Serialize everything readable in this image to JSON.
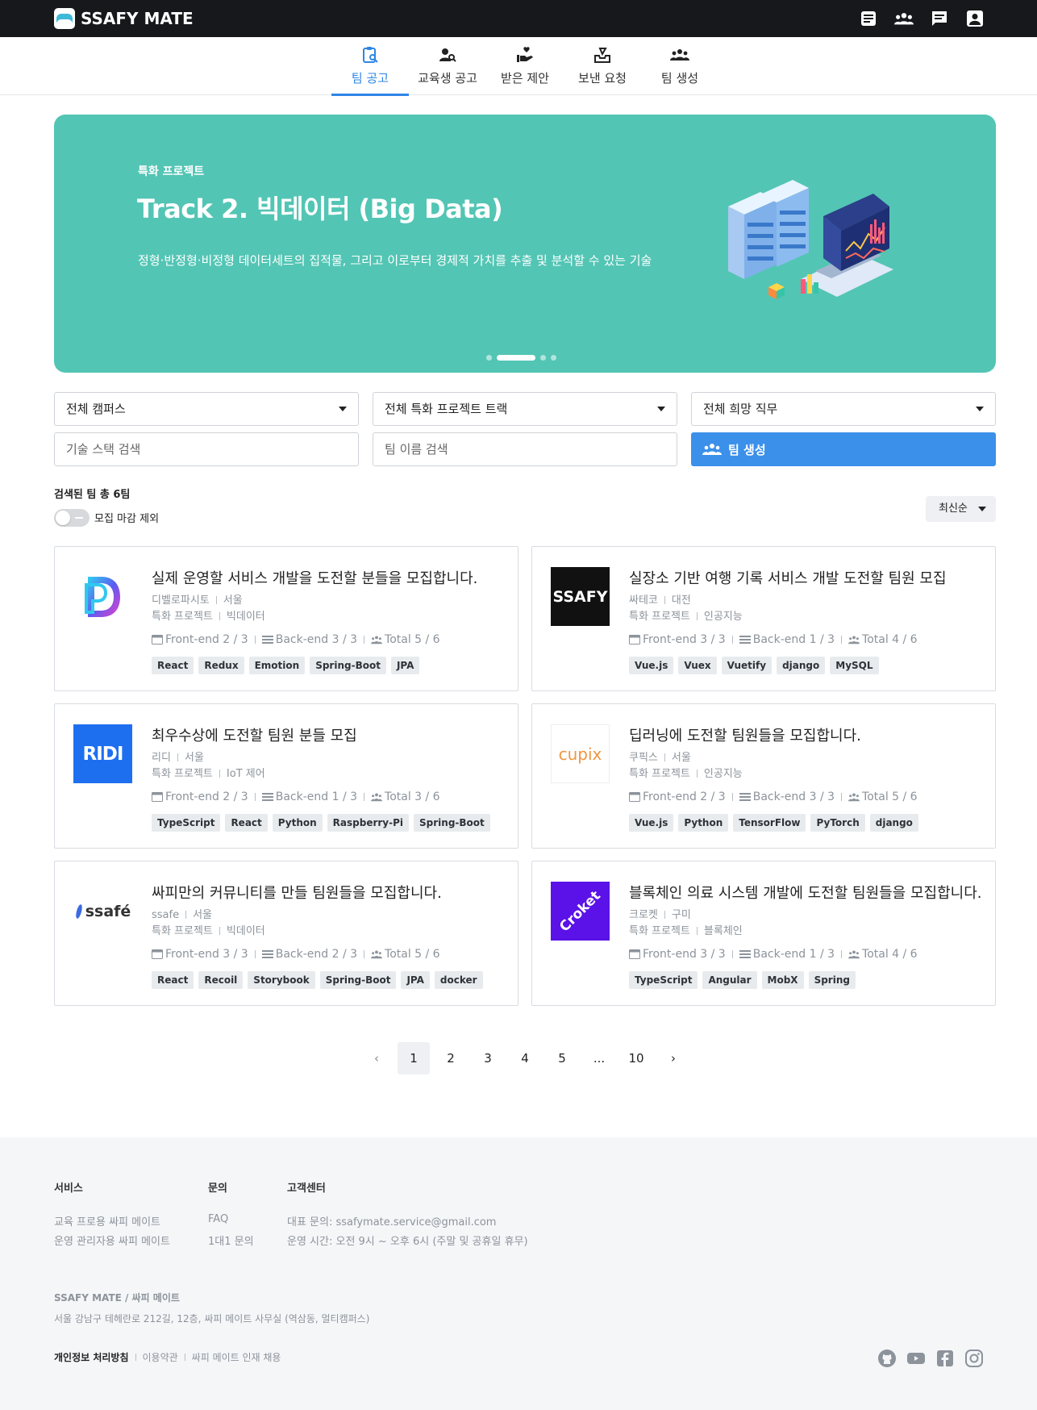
{
  "app": {
    "brand": "SSAFY MATE",
    "top_icons": [
      "notes-icon",
      "team-icon",
      "chat-icon",
      "profile-icon"
    ]
  },
  "tabs": [
    {
      "label": "팀 공고",
      "icon": "clipboard-search-icon",
      "active": true
    },
    {
      "label": "교육생 공고",
      "icon": "person-search-icon",
      "active": false
    },
    {
      "label": "받은 제안",
      "icon": "hand-heart-icon",
      "active": false
    },
    {
      "label": "보낸 요청",
      "icon": "outbox-icon",
      "active": false
    },
    {
      "label": "팀 생성",
      "icon": "group-icon",
      "active": false
    }
  ],
  "banner": {
    "kicker": "특화 프로젝트",
    "title": "Track 2. 빅데이터 (Big Data)",
    "description": "정형·반정형·비정형 데이터세트의 집적물, 그리고 이로부터 경제적 가치를 추출 및 분석할 수 있는 기술",
    "slide_count": 4,
    "active_slide": 1,
    "color": "#53c5b4"
  },
  "filters": {
    "campus": "전체 캠퍼스",
    "track": "전체 특화 프로젝트 트랙",
    "role": "전체 희망 직무",
    "stack_placeholder": "기술 스택 검색",
    "team_placeholder": "팀 이름 검색",
    "create_button": "팀 생성"
  },
  "results": {
    "count_text": "검색된 팀 총 6팀",
    "toggle_label": "모집 마감 제외",
    "toggle_on": false,
    "sort": "최신순"
  },
  "cards": [
    {
      "logo": "D",
      "title": "실제 운영할 서비스 개발을 도전할 분들을 모집합니다.",
      "company": "디벨로파시토",
      "region": "서울",
      "category": "특화 프로젝트",
      "track": "빅데이터",
      "front": "Front-end 2 / 3",
      "back": "Back-end 3 / 3",
      "total": "Total 5 / 6",
      "tags": [
        "React",
        "Redux",
        "Emotion",
        "Spring-Boot",
        "JPA"
      ]
    },
    {
      "logo": "SSAFY",
      "title": "실장소 기반 여행 기록 서비스 개발 도전할 팀원 모집",
      "company": "싸테코",
      "region": "대전",
      "category": "특화 프로젝트",
      "track": "인공지능",
      "front": "Front-end 3 / 3",
      "back": "Back-end 1 / 3",
      "total": "Total 4 / 6",
      "tags": [
        "Vue.js",
        "Vuex",
        "Vuetify",
        "django",
        "MySQL"
      ]
    },
    {
      "logo": "RIDI",
      "title": "최우수상에 도전할 팀원 분들 모집",
      "company": "리디",
      "region": "서울",
      "category": "특화 프로젝트",
      "track": "IoT 제어",
      "front": "Front-end 2 / 3",
      "back": "Back-end 1 / 3",
      "total": "Total 3 / 6",
      "tags": [
        "TypeScript",
        "React",
        "Python",
        "Raspberry-Pi",
        "Spring-Boot"
      ]
    },
    {
      "logo": "cupix",
      "title": "딥러닝에 도전할 팀원들을 모집합니다.",
      "company": "쿠픽스",
      "region": "서울",
      "category": "특화 프로젝트",
      "track": "인공지능",
      "front": "Front-end 2 / 3",
      "back": "Back-end 3 / 3",
      "total": "Total 5 / 6",
      "tags": [
        "Vue.js",
        "Python",
        "TensorFlow",
        "PyTorch",
        "django"
      ]
    },
    {
      "logo": "ssafé",
      "title": "싸피만의 커뮤니티를 만들 팀원들을 모집합니다.",
      "company": "ssafe",
      "region": "서울",
      "category": "특화 프로젝트",
      "track": "빅데이터",
      "front": "Front-end 3 / 3",
      "back": "Back-end 2 / 3",
      "total": "Total 5 / 6",
      "tags": [
        "React",
        "Recoil",
        "Storybook",
        "Spring-Boot",
        "JPA",
        "docker"
      ]
    },
    {
      "logo": "Croket",
      "title": "블록체인 의료 시스템 개발에 도전할 팀원들을 모집합니다.",
      "company": "크로켓",
      "region": "구미",
      "category": "특화 프로젝트",
      "track": "블록체인",
      "front": "Front-end 3 / 3",
      "back": "Back-end 1 / 3",
      "total": "Total 4 / 6",
      "tags": [
        "TypeScript",
        "Angular",
        "MobX",
        "Spring"
      ]
    }
  ],
  "pagination": {
    "pages": [
      "1",
      "2",
      "3",
      "4",
      "5",
      "...",
      "10"
    ],
    "current": "1",
    "prev": "‹",
    "next": "›"
  },
  "footer": {
    "service_title": "서비스",
    "service_links": [
      "교육 프로용 싸피 메이트",
      "운영 관리자용 싸피 메이트"
    ],
    "inquiry_title": "문의",
    "inquiry_links": [
      "FAQ",
      "1대1 문의"
    ],
    "support_title": "고객센터",
    "support_email": "대표 문의: ssafymate.service@gmail.com",
    "support_hours": "운영 시간: 오전 9시 ~ 오후 6시 (주말 및 공휴일 휴무)",
    "brand": "SSAFY MATE / 싸피 메이트",
    "address": "서울 강남구 테헤란로 212길, 12층, 싸피 메이트 사무실 (역삼동, 멀티캠퍼스)",
    "bottom_links": [
      "개인정보 처리방침",
      "이용약관",
      "싸피 메이트 인재 채용"
    ],
    "social": [
      "github-icon",
      "youtube-icon",
      "facebook-icon",
      "instagram-icon"
    ]
  }
}
